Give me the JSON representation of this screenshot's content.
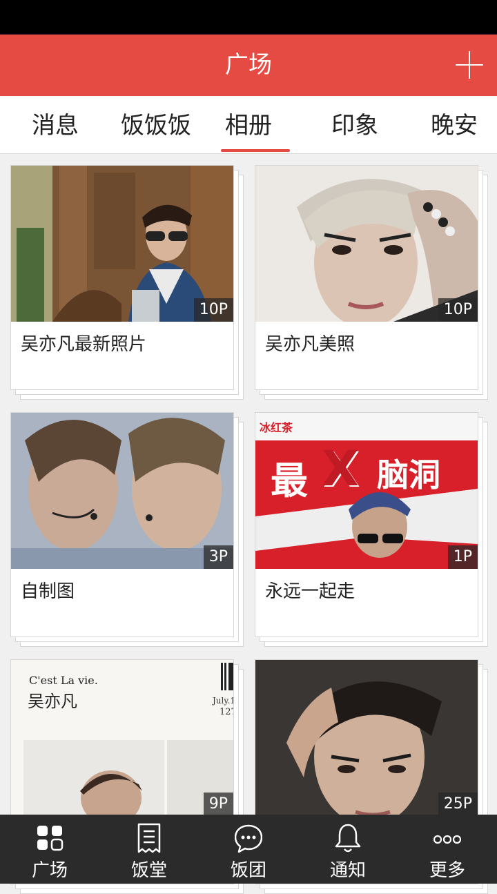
{
  "header": {
    "title": "广场",
    "add_icon": "plus-icon"
  },
  "tabs": [
    {
      "label": "消息",
      "active": false
    },
    {
      "label": "饭饭饭",
      "active": false
    },
    {
      "label": "相册",
      "active": true
    },
    {
      "label": "印象",
      "active": false
    },
    {
      "label": "晚安",
      "active": false
    }
  ],
  "albums": [
    {
      "title": "吴亦凡最新照片",
      "count": "10P"
    },
    {
      "title": "吴亦凡美照",
      "count": "10P"
    },
    {
      "title": "自制图",
      "count": "3P"
    },
    {
      "title": "永远一起走",
      "count": "1P"
    },
    {
      "title": "",
      "count": "9P",
      "photo_text": {
        "line1": "C'est La vie.",
        "line2": "吴亦凡",
        "date": "July.1",
        "num": "127"
      }
    },
    {
      "title": "",
      "count": "25P"
    }
  ],
  "ad_banner": {
    "brand": "冰红茶",
    "text_left": "最",
    "text_x": "X",
    "text_right": "脑洞"
  },
  "bottom_nav": [
    {
      "label": "广场",
      "icon": "grid-icon"
    },
    {
      "label": "饭堂",
      "icon": "document-icon"
    },
    {
      "label": "饭团",
      "icon": "chat-bubble-icon"
    },
    {
      "label": "通知",
      "icon": "bell-icon"
    },
    {
      "label": "更多",
      "icon": "more-dots-icon"
    }
  ],
  "colors": {
    "accent": "#e54b42",
    "bottom_bar": "#2b2b2b",
    "badge": "#282828"
  }
}
